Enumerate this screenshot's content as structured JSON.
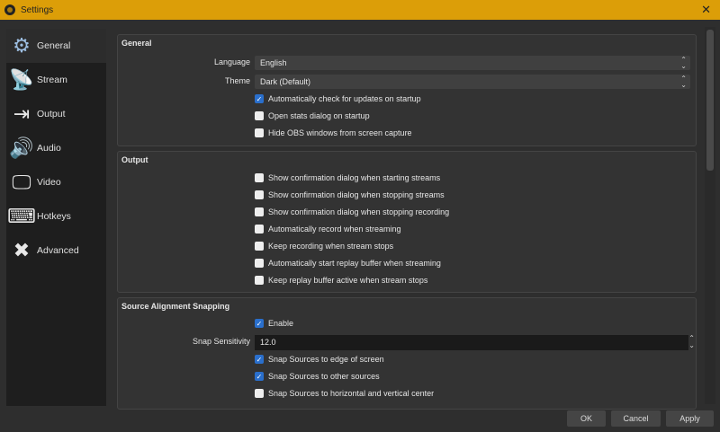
{
  "window": {
    "title": "Settings",
    "close": "✕"
  },
  "sidebar": {
    "items": [
      {
        "label": "General",
        "icon": "gear-icon",
        "glyph": "⚙"
      },
      {
        "label": "Stream",
        "icon": "antenna-icon",
        "glyph": "📡"
      },
      {
        "label": "Output",
        "icon": "output-icon",
        "glyph": "⇥"
      },
      {
        "label": "Audio",
        "icon": "speaker-icon",
        "glyph": "🔊"
      },
      {
        "label": "Video",
        "icon": "monitor-icon",
        "glyph": "🖵"
      },
      {
        "label": "Hotkeys",
        "icon": "keyboard-icon",
        "glyph": "⌨"
      },
      {
        "label": "Advanced",
        "icon": "tools-icon",
        "glyph": "✖"
      }
    ]
  },
  "general": {
    "title": "General",
    "language_label": "Language",
    "language_value": "English",
    "theme_label": "Theme",
    "theme_value": "Dark (Default)",
    "checks": [
      {
        "label": "Automatically check for updates on startup",
        "checked": true
      },
      {
        "label": "Open stats dialog on startup",
        "checked": false
      },
      {
        "label": "Hide OBS windows from screen capture",
        "checked": false
      }
    ]
  },
  "output": {
    "title": "Output",
    "checks": [
      {
        "label": "Show confirmation dialog when starting streams",
        "checked": false
      },
      {
        "label": "Show confirmation dialog when stopping streams",
        "checked": false
      },
      {
        "label": "Show confirmation dialog when stopping recording",
        "checked": false
      },
      {
        "label": "Automatically record when streaming",
        "checked": false
      },
      {
        "label": "Keep recording when stream stops",
        "checked": false
      },
      {
        "label": "Automatically start replay buffer when streaming",
        "checked": false
      },
      {
        "label": "Keep replay buffer active when stream stops",
        "checked": false
      }
    ]
  },
  "snapping": {
    "title": "Source Alignment Snapping",
    "enable_label": "Enable",
    "enable_checked": true,
    "sensitivity_label": "Snap Sensitivity",
    "sensitivity_value": "12.0",
    "checks": [
      {
        "label": "Snap Sources to edge of screen",
        "checked": true
      },
      {
        "label": "Snap Sources to other sources",
        "checked": true
      },
      {
        "label": "Snap Sources to horizontal and vertical center",
        "checked": false
      }
    ]
  },
  "buttons": {
    "ok": "OK",
    "cancel": "Cancel",
    "apply": "Apply"
  }
}
